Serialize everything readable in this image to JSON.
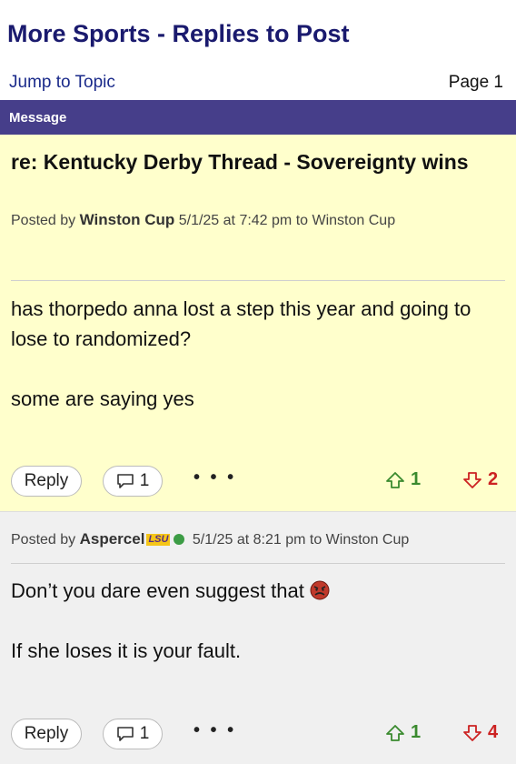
{
  "page": {
    "title": "More Sports - Replies to Post",
    "jump_label": "Jump to Topic",
    "page_label": "Page 1"
  },
  "header": {
    "message_label": "Message"
  },
  "posts": [
    {
      "subject": "re: Kentucky Derby Thread - Sovereignty wins",
      "posted_by_label": "Posted by",
      "author": "Winston Cup",
      "datetime": "5/1/25 at 7:42 pm",
      "to_label": "to",
      "to_user": "Winston Cup",
      "body": [
        "has thorpedo anna lost a step this year and going to lose to randomized?",
        "some are saying yes"
      ],
      "reply_label": "Reply",
      "reply_count": "1",
      "more_label": "• • •",
      "upvotes": "1",
      "downvotes": "2"
    },
    {
      "posted_by_label": "Posted by",
      "author": "Aspercel",
      "badge": "LSU",
      "datetime": "5/1/25 at 8:21 pm",
      "to_label": "to",
      "to_user": "Winston Cup",
      "body": [
        "Don’t you dare even suggest that",
        "If she loses it is your fault."
      ],
      "reply_label": "Reply",
      "reply_count": "1",
      "more_label": "• • •",
      "upvotes": "1",
      "downvotes": "4"
    }
  ],
  "colors": {
    "header_bg": "#463e8a",
    "post_bg": "#ffffcc",
    "reply_bg": "#f0f0f0",
    "title": "#1a1a6e",
    "up": "#3a8a2e",
    "down": "#cc2222"
  },
  "icons": {
    "comment": "comment-bubble-icon",
    "upvote": "arrow-up-icon",
    "downvote": "arrow-down-icon",
    "online": "online-dot-icon",
    "emoji": "angry-face-icon"
  }
}
